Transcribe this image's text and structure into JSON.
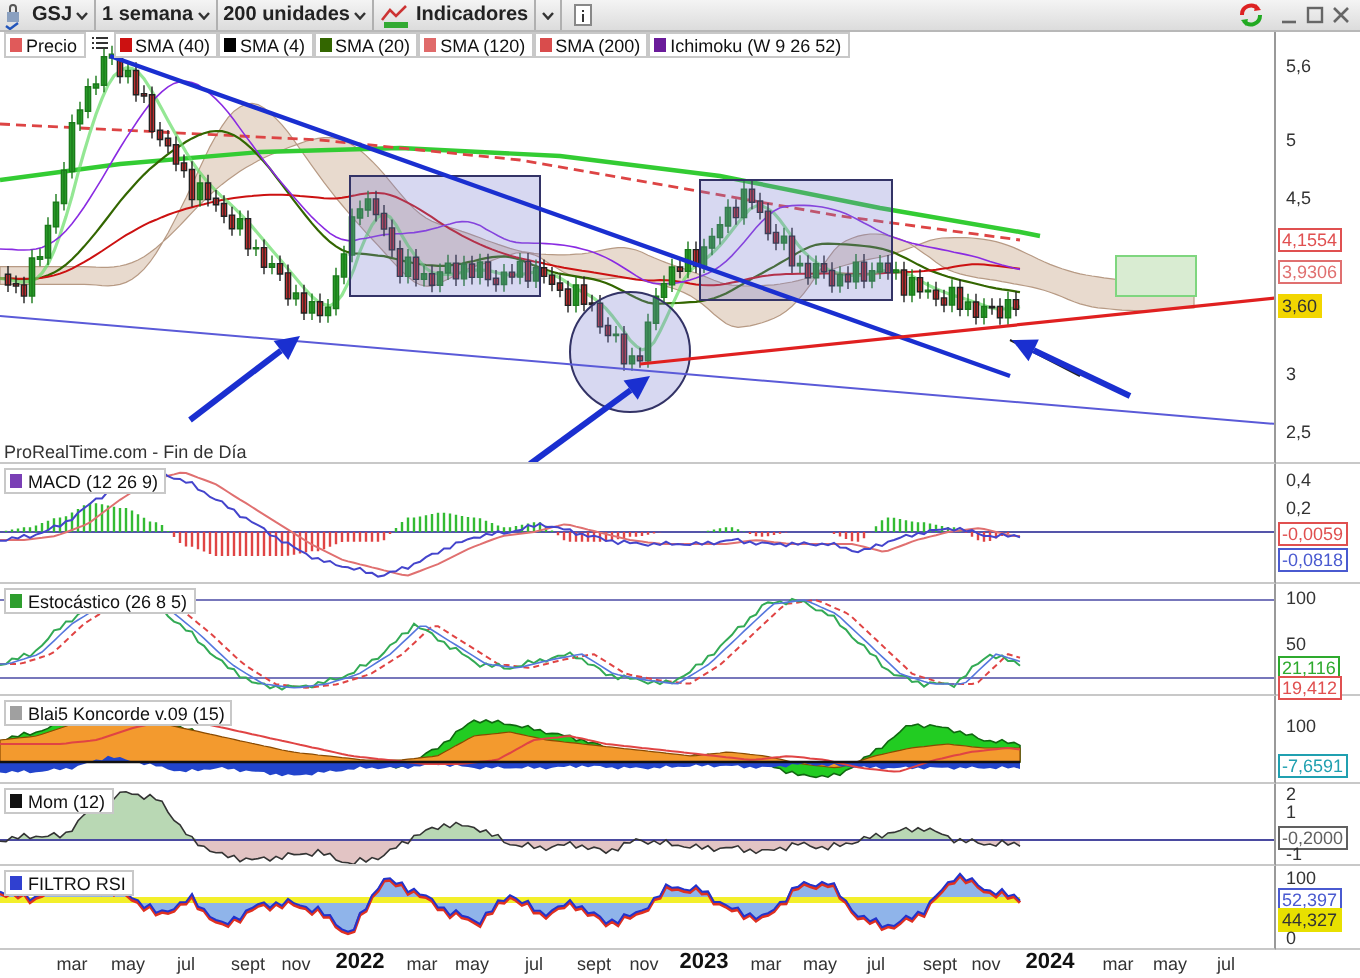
{
  "toolbar": {
    "symbol": "GSJ",
    "period": "1 semana",
    "units": "200 unidades",
    "indicators_button": "Indicadores"
  },
  "legend": [
    {
      "label": "Precio",
      "color": "#e05a5a"
    },
    {
      "label": "SMA (40)",
      "color": "#cc1111"
    },
    {
      "label": "SMA (4)",
      "color": "#000000"
    },
    {
      "label": "SMA (20)",
      "color": "#336600"
    },
    {
      "label": "SMA (120)",
      "color": "#e06a6a"
    },
    {
      "label": "SMA (200)",
      "color": "#d94c4c"
    },
    {
      "label": "Ichimoku (W 9 26 52)",
      "color": "#6a1b9a"
    }
  ],
  "main_chart": {
    "source": "ProRealTime.com - Fin de Día",
    "axis_labels": [
      {
        "text": "5,6",
        "kind": "tick"
      },
      {
        "text": "5",
        "kind": "tick"
      },
      {
        "text": "4,5",
        "kind": "tick"
      },
      {
        "text": "4,1554",
        "kind": "value",
        "color": "#e05050"
      },
      {
        "text": "3,9306",
        "kind": "value",
        "color": "#e07070"
      },
      {
        "text": "3,60",
        "kind": "value",
        "color": "#f2d600"
      },
      {
        "text": "3",
        "kind": "tick"
      },
      {
        "text": "2,5",
        "kind": "tick"
      }
    ]
  },
  "indicators": [
    {
      "kind": "macd",
      "label": "MACD (12 26 9)",
      "color": "#7a3fb5",
      "axis_labels": [
        {
          "text": "0,4",
          "kind": "tick"
        },
        {
          "text": "0,2",
          "kind": "tick"
        },
        {
          "text": "-0,0059",
          "kind": "value",
          "color": "#e05050"
        },
        {
          "text": "-0,0818",
          "kind": "value",
          "color": "#4a5ad0"
        }
      ]
    },
    {
      "kind": "stochastic",
      "label": "Estocástico (26 8 5)",
      "color": "#2e9e2e",
      "axis_labels": [
        {
          "text": "100",
          "kind": "tick"
        },
        {
          "text": "50",
          "kind": "tick"
        },
        {
          "text": "21,116",
          "kind": "value",
          "color": "#2eaa2e"
        },
        {
          "text": "19,412",
          "kind": "value",
          "color": "#e05050"
        }
      ]
    },
    {
      "kind": "koncorde",
      "label": "Blai5 Koncorde v.09 (15)",
      "color": "#a0a0a0",
      "axis_labels": [
        {
          "text": "100",
          "kind": "tick"
        },
        {
          "text": "-7,6591",
          "kind": "value",
          "color": "#20a0b0"
        }
      ]
    },
    {
      "kind": "momentum",
      "label": "Mom (12)",
      "color": "#111111",
      "axis_labels": [
        {
          "text": "2",
          "kind": "tick"
        },
        {
          "text": "1",
          "kind": "tick"
        },
        {
          "text": "-0,2000",
          "kind": "value",
          "color": "#606060"
        },
        {
          "text": "-1",
          "kind": "tick"
        }
      ]
    },
    {
      "kind": "rsi",
      "label": "FILTRO RSI",
      "color": "#3040d0",
      "axis_labels": [
        {
          "text": "100",
          "kind": "tick"
        },
        {
          "text": "52,397",
          "kind": "value",
          "color": "#4a5ad0"
        },
        {
          "text": "44,327",
          "kind": "value",
          "color": "#e8e000"
        },
        {
          "text": "0",
          "kind": "tick"
        }
      ]
    }
  ],
  "x_axis": [
    {
      "label": "mar",
      "kind": "month"
    },
    {
      "label": "may",
      "kind": "month"
    },
    {
      "label": "jul",
      "kind": "month"
    },
    {
      "label": "sept",
      "kind": "month"
    },
    {
      "label": "nov",
      "kind": "month"
    },
    {
      "label": "2022",
      "kind": "year"
    },
    {
      "label": "mar",
      "kind": "month"
    },
    {
      "label": "may",
      "kind": "month"
    },
    {
      "label": "jul",
      "kind": "month"
    },
    {
      "label": "sept",
      "kind": "month"
    },
    {
      "label": "nov",
      "kind": "month"
    },
    {
      "label": "2023",
      "kind": "year"
    },
    {
      "label": "mar",
      "kind": "month"
    },
    {
      "label": "may",
      "kind": "month"
    },
    {
      "label": "jul",
      "kind": "month"
    },
    {
      "label": "sept",
      "kind": "month"
    },
    {
      "label": "nov",
      "kind": "month"
    },
    {
      "label": "2024",
      "kind": "year"
    },
    {
      "label": "mar",
      "kind": "month"
    },
    {
      "label": "may",
      "kind": "month"
    },
    {
      "label": "jul",
      "kind": "month"
    }
  ]
}
